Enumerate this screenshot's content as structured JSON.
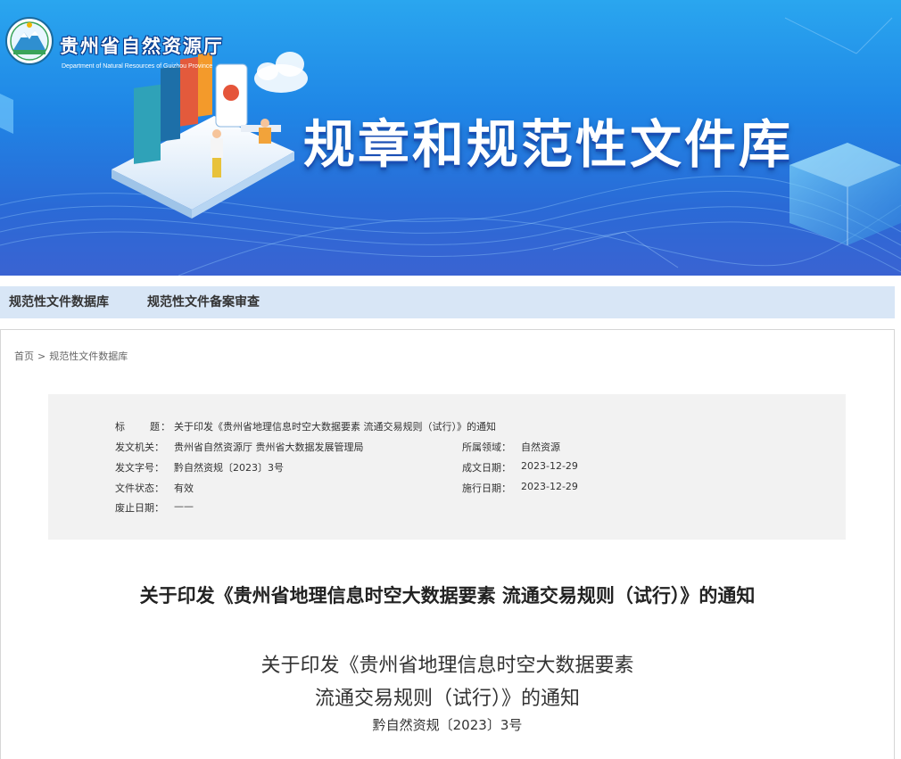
{
  "header": {
    "org_name_cn": "贵州省自然资源厅",
    "org_name_en": "Department of Natural Resources of Guizhou Province",
    "banner_title": "规章和规范性文件库",
    "colors": {
      "banner_top": "#2aa6ef",
      "banner_bottom": "#3a63d2",
      "nav_bg": "#d8e6f6"
    }
  },
  "nav": {
    "items": [
      {
        "label": "规范性文件数据库"
      },
      {
        "label": "规范性文件备案审查"
      }
    ]
  },
  "breadcrumb": {
    "home": "首页",
    "separator": ">",
    "current": "规范性文件数据库"
  },
  "meta": {
    "title_label_chars": [
      "标",
      "题"
    ],
    "title_label_colon": "：",
    "title_value": "关于印发《贵州省地理信息时空大数据要素 流通交易规则（试行）》的通知",
    "issuer_label": "发文机关：",
    "issuer_value": "贵州省自然资源厅 贵州省大数据发展管理局",
    "domain_label": "所属领域：",
    "domain_value": "自然资源",
    "docno_label": "发文字号：",
    "docno_value": "黔自然资规〔2023〕3号",
    "created_label": "成文日期：",
    "created_value": "2023-12-29",
    "status_label": "文件状态：",
    "status_value": "有效",
    "effective_label": "施行日期：",
    "effective_value": "2023-12-29",
    "repeal_label": "废止日期：",
    "repeal_value": "——"
  },
  "document": {
    "heading": "关于印发《贵州省地理信息时空大数据要素 流通交易规则（试行）》的通知",
    "body_title_line1": "关于印发《贵州省地理信息时空大数据要素",
    "body_title_line2": "流通交易规则（试行）》的通知",
    "body_docno": "黔自然资规〔2023〕3号"
  }
}
